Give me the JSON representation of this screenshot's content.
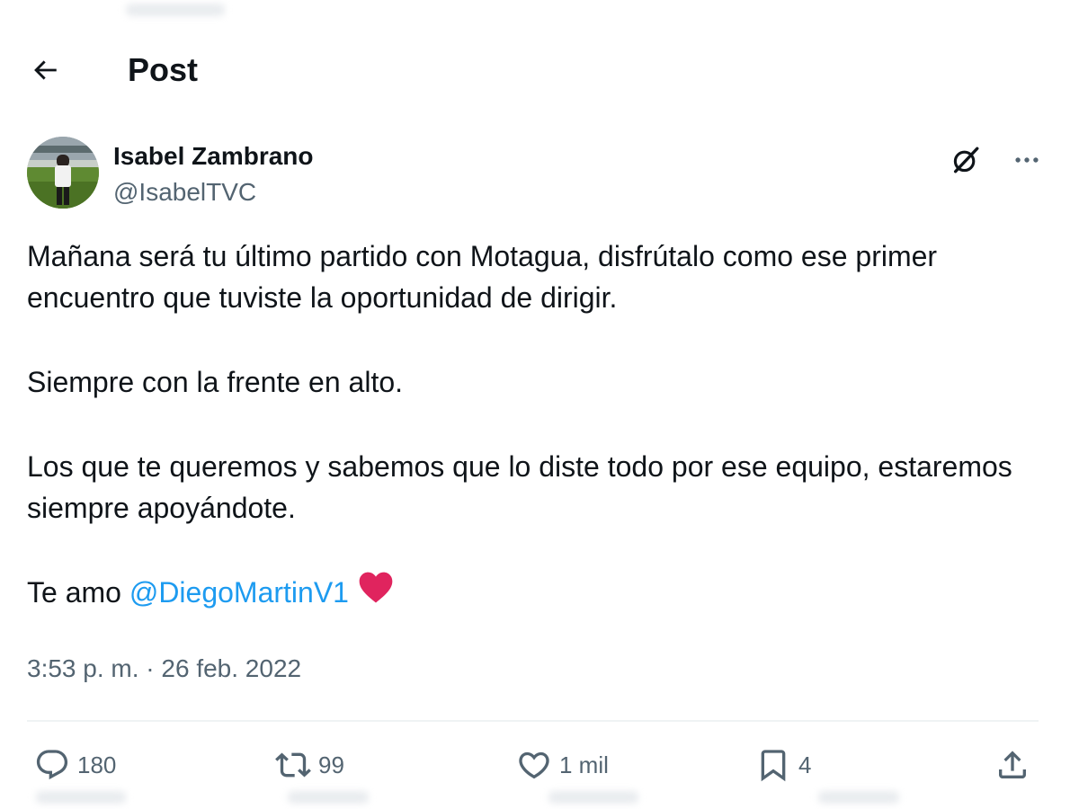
{
  "header": {
    "title": "Post",
    "back_icon": "arrow-left-icon"
  },
  "author": {
    "name": "Isabel Zambrano",
    "handle": "@IsabelTVC"
  },
  "top_actions": {
    "grok_icon": "grok-icon",
    "more_label": "···"
  },
  "post": {
    "paragraph_1": "Mañana será tu último partido con Motagua, disfrútalo como ese primer encuentro que tuviste la oportunidad de dirigir.",
    "paragraph_2": "Siempre con la frente en alto.",
    "paragraph_3": "Los que te queremos y sabemos que lo diste todo por ese equipo, estaremos siempre apoyándote.",
    "paragraph_4_prefix": "Te amo ",
    "mention": "@DiegoMartinV1",
    "emoji": "red-heart-emoji",
    "timestamp": "3:53 p. m. · 26 feb. 2022"
  },
  "actions": {
    "replies": "180",
    "reposts": "99",
    "likes": "1 mil",
    "bookmarks": "4"
  },
  "colors": {
    "text": "#0f1419",
    "secondary": "#536471",
    "link": "#1d9bf0",
    "heart": "#e0245e",
    "divider": "#eff3f4"
  }
}
